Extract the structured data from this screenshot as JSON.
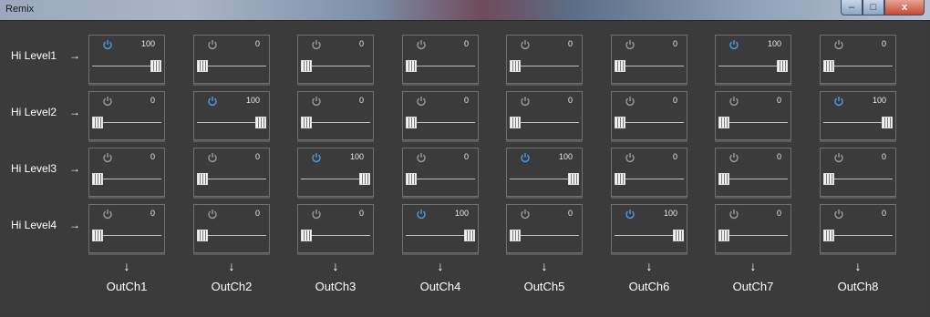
{
  "window": {
    "title": "Remix",
    "min_icon": "minimize-icon",
    "max_icon": "maximize-icon",
    "close_icon": "close-icon"
  },
  "colors": {
    "power_active": "#4a9be8",
    "power_inactive": "#9a9a9a"
  },
  "rows": [
    {
      "label": "Hi Level1",
      "arrow": "→"
    },
    {
      "label": "Hi Level2",
      "arrow": "→"
    },
    {
      "label": "Hi Level3",
      "arrow": "→"
    },
    {
      "label": "Hi Level4",
      "arrow": "→"
    }
  ],
  "outputs": [
    {
      "label": "OutCh1",
      "arrow": "↓"
    },
    {
      "label": "OutCh2",
      "arrow": "↓"
    },
    {
      "label": "OutCh3",
      "arrow": "↓"
    },
    {
      "label": "OutCh4",
      "arrow": "↓"
    },
    {
      "label": "OutCh5",
      "arrow": "↓"
    },
    {
      "label": "OutCh6",
      "arrow": "↓"
    },
    {
      "label": "OutCh7",
      "arrow": "↓"
    },
    {
      "label": "OutCh8",
      "arrow": "↓"
    }
  ],
  "matrix": [
    [
      {
        "value": "100",
        "level": 100,
        "on": true
      },
      {
        "value": "0",
        "level": 0,
        "on": false
      },
      {
        "value": "0",
        "level": 0,
        "on": false
      },
      {
        "value": "0",
        "level": 0,
        "on": false
      },
      {
        "value": "0",
        "level": 0,
        "on": false
      },
      {
        "value": "0",
        "level": 0,
        "on": false
      },
      {
        "value": "100",
        "level": 100,
        "on": true
      },
      {
        "value": "0",
        "level": 0,
        "on": false
      }
    ],
    [
      {
        "value": "0",
        "level": 0,
        "on": false
      },
      {
        "value": "100",
        "level": 100,
        "on": true
      },
      {
        "value": "0",
        "level": 0,
        "on": false
      },
      {
        "value": "0",
        "level": 0,
        "on": false
      },
      {
        "value": "0",
        "level": 0,
        "on": false
      },
      {
        "value": "0",
        "level": 0,
        "on": false
      },
      {
        "value": "0",
        "level": 0,
        "on": false
      },
      {
        "value": "100",
        "level": 100,
        "on": true
      }
    ],
    [
      {
        "value": "0",
        "level": 0,
        "on": false
      },
      {
        "value": "0",
        "level": 0,
        "on": false
      },
      {
        "value": "100",
        "level": 100,
        "on": true
      },
      {
        "value": "0",
        "level": 0,
        "on": false
      },
      {
        "value": "100",
        "level": 100,
        "on": true
      },
      {
        "value": "0",
        "level": 0,
        "on": false
      },
      {
        "value": "0",
        "level": 0,
        "on": false
      },
      {
        "value": "0",
        "level": 0,
        "on": false
      }
    ],
    [
      {
        "value": "0",
        "level": 0,
        "on": false
      },
      {
        "value": "0",
        "level": 0,
        "on": false
      },
      {
        "value": "0",
        "level": 0,
        "on": false
      },
      {
        "value": "100",
        "level": 100,
        "on": true
      },
      {
        "value": "0",
        "level": 0,
        "on": false
      },
      {
        "value": "100",
        "level": 100,
        "on": true
      },
      {
        "value": "0",
        "level": 0,
        "on": false
      },
      {
        "value": "0",
        "level": 0,
        "on": false
      }
    ]
  ]
}
